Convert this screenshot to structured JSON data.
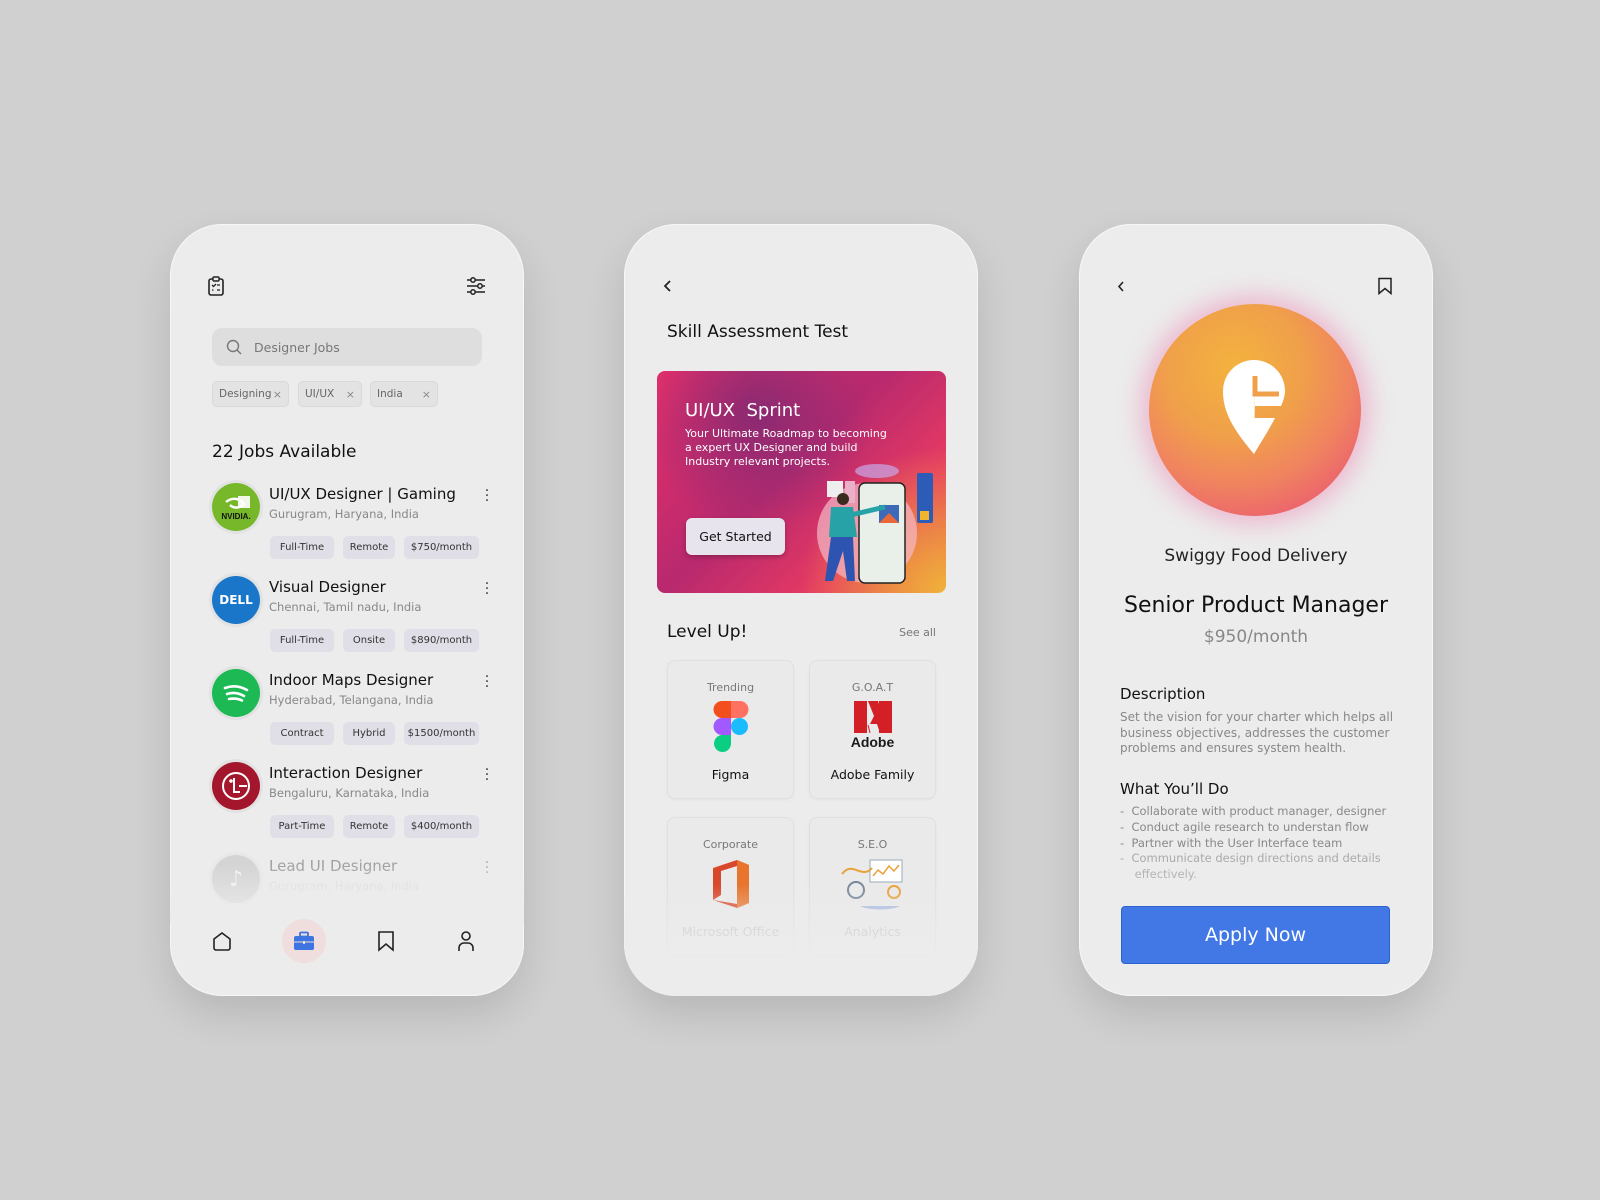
{
  "screen1": {
    "search_placeholder": "Designer Jobs",
    "filters": [
      {
        "label": "Designing"
      },
      {
        "label": "UI/UX"
      },
      {
        "label": "India"
      }
    ],
    "jobs_count_title": "22 Jobs Available",
    "jobs": [
      {
        "company": "NVIDIA",
        "logo_color": "#76b82a",
        "title": "UI/UX Designer | Gaming",
        "location": "Gurugram, Haryana, India",
        "tags": [
          "Full-Time",
          "Remote",
          "$750/month"
        ]
      },
      {
        "company": "DELL",
        "logo_color": "#1a76c8",
        "title": "Visual Designer",
        "location": "Chennai, Tamil nadu, India",
        "tags": [
          "Full-Time",
          "Onsite",
          "$890/month"
        ]
      },
      {
        "company": "Spotify",
        "logo_color": "#1db954",
        "title": "Indoor Maps Designer",
        "location": "Hyderabad, Telangana, India",
        "tags": [
          "Contract",
          "Hybrid",
          "$1500/month"
        ]
      },
      {
        "company": "LG",
        "logo_color": "#a3162b",
        "title": "Interaction Designer",
        "location": "Bengaluru, Karnataka, India",
        "tags": [
          "Part-Time",
          "Remote",
          "$400/month"
        ]
      },
      {
        "company": "TikTok",
        "logo_color": "#bdbdbd",
        "title": "Lead UI Designer",
        "location": "Gurugram, Haryana, India",
        "tags": []
      }
    ],
    "nav": [
      {
        "icon": "home-icon"
      },
      {
        "icon": "briefcase-icon",
        "active": true
      },
      {
        "icon": "bookmark-icon"
      },
      {
        "icon": "user-icon"
      }
    ],
    "accent": "#3d74e0"
  },
  "screen2": {
    "title": "Skill Assessment Test",
    "banner": {
      "title": "UI/UX  Sprint",
      "lines": [
        "Your Ultimate Roadmap to becoming",
        "a expert UX Designer and build",
        "Industry relevant projects."
      ],
      "button": "Get Started"
    },
    "section_title": "Level Up!",
    "see_all": "See all",
    "cards": [
      {
        "label": "Trending",
        "name": "Figma"
      },
      {
        "label": "G.O.A.T",
        "name": "Adobe Family",
        "logo_text": "Adobe"
      },
      {
        "label": "Corporate",
        "name": "Microsoft Office"
      },
      {
        "label": "S.E.O",
        "name": "Analytics"
      }
    ]
  },
  "screen3": {
    "company": "Swiggy Food Delivery",
    "role": "Senior Product Manager",
    "salary": "$950/month",
    "description_title": "Description",
    "description": [
      "Set the vision for your charter which helps all",
      "business objectives, addresses the customer",
      "problems and ensures system health."
    ],
    "todo_title": "What You’ll Do",
    "todo": [
      "-  Collaborate with product manager, designer",
      "-  Conduct agile research to understan flow",
      "-  Partner with the User Interface team",
      "-  Communicate design directions and details",
      "    effectively."
    ],
    "apply_label": "Apply Now",
    "apply_color": "#4178e6"
  }
}
